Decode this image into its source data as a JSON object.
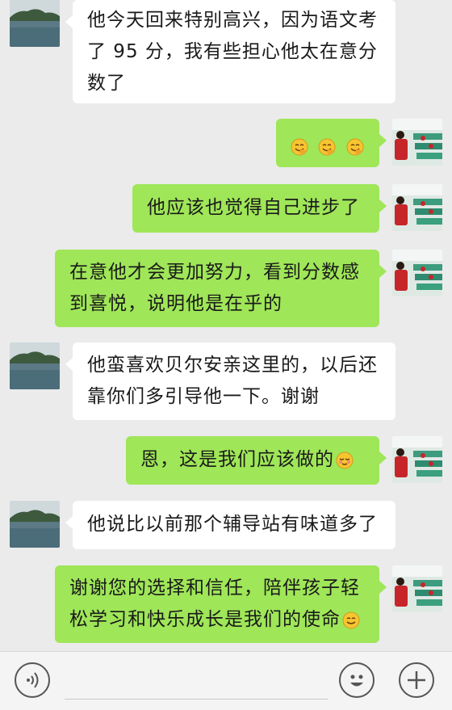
{
  "chat": {
    "messages": [
      {
        "side": "left",
        "lines": [
          "他今天回来特别高兴，因为语文考",
          "了 95 分，我有些担心他太在意分",
          "数了"
        ]
      },
      {
        "side": "right",
        "lines": [
          ""
        ],
        "emoji_only": [
          "grin-hand-emoji",
          "grin-hand-emoji",
          "grin-hand-emoji"
        ]
      },
      {
        "side": "right",
        "lines": [
          "他应该也觉得自己进步了"
        ]
      },
      {
        "side": "right",
        "lines": [
          "在意他才会更加努力，看到分数感",
          "到喜悦，说明他是在乎的"
        ]
      },
      {
        "side": "left",
        "lines": [
          "他蛮喜欢贝尔安亲这里的，以后还",
          "靠你们多引导他一下。谢谢"
        ]
      },
      {
        "side": "right",
        "lines": [
          "恩，这是我们应该做的"
        ],
        "trailing_emoji": "shy-smile-emoji"
      },
      {
        "side": "left",
        "lines": [
          "他说比以前那个辅导站有味道多了"
        ]
      },
      {
        "side": "right",
        "lines": [
          "谢谢您的选择和信任，陪伴孩子轻",
          "松学习和快乐成长是我们的使命"
        ],
        "trailing_emoji": "smile-emoji"
      }
    ]
  },
  "colors": {
    "sent_bubble": "#9fe658",
    "received_bubble": "#ffffff",
    "background": "#ebebeb",
    "emoji_yellow": "#f7c531"
  },
  "input_bar": {
    "left_icon": "voice-icon",
    "emoji_button_icon": "emoji-face-icon",
    "plus_button_icon": "plus-icon"
  }
}
